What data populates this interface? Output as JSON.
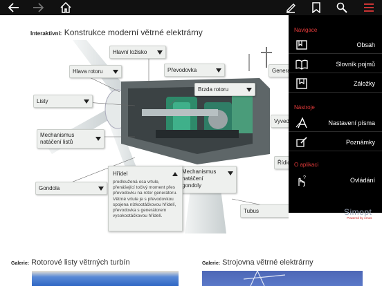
{
  "toolbar": {
    "back_icon": "arrow-left-icon",
    "forward_icon": "arrow-right-icon",
    "home_icon": "home-icon",
    "annotate_icon": "pencil-icon",
    "bookmark_icon": "bookmark-icon",
    "search_icon": "search-icon",
    "menu_icon": "hamburger-icon",
    "menu_color": "#e23a3a"
  },
  "main": {
    "heading_prefix": "Interaktivní:",
    "heading_title": "Konstrukce moderní větrné elektrárny",
    "labels": {
      "hlavni_lozisko": "Hlavní ložisko",
      "hlava_rotoru": "Hlava rotoru",
      "prevodovka": "Převodovka",
      "generator": "Genera",
      "brzda_rotoru": "Brzda rotoru",
      "listy": "Listy",
      "vyved": "Vyved",
      "mechanismus_listu_1": "Mechanismus",
      "mechanismus_listu_2": "natáčení listů",
      "ridici": "Řídic",
      "mechanismus_gondoly_1": "Mechanismus",
      "mechanismus_gondoly_2": "natáčení",
      "mechanismus_gondoly_3": "gondoly",
      "gondola": "Gondola",
      "tubus": "Tubus"
    },
    "popup": {
      "title": "Hřídel",
      "body": "prodloužená osa vrtule, přenášející točivý moment přes převodovku na rotor generátoru. Větrné vrtule je s převodovkou spojena nízkootáčkovou hřídelí, převodovka s generátorem vysokootáčkovou hřídelí."
    }
  },
  "galleries": [
    {
      "prefix": "Galerie:",
      "title": "Rotorové listy větrných turbín"
    },
    {
      "prefix": "Galerie:",
      "title": "Strojovna větrné elektrárny"
    }
  ],
  "menu": {
    "section_nav": "Navigace",
    "section_tools": "Nástroje",
    "section_about": "O aplikaci",
    "items": [
      {
        "label": "Obsah",
        "icon": "contents-icon"
      },
      {
        "label": "Slovník pojmů",
        "icon": "book-icon"
      },
      {
        "label": "Záložky",
        "icon": "bookmarks-icon"
      },
      {
        "label": "Nastavení písma",
        "icon": "font-settings-icon"
      },
      {
        "label": "Poznámky",
        "icon": "notes-icon"
      },
      {
        "label": "Ovládání",
        "icon": "gesture-help-icon"
      }
    ],
    "brand": "Simopt",
    "brand_sub": "Powered by Amos",
    "accent": "#e23a3a"
  }
}
